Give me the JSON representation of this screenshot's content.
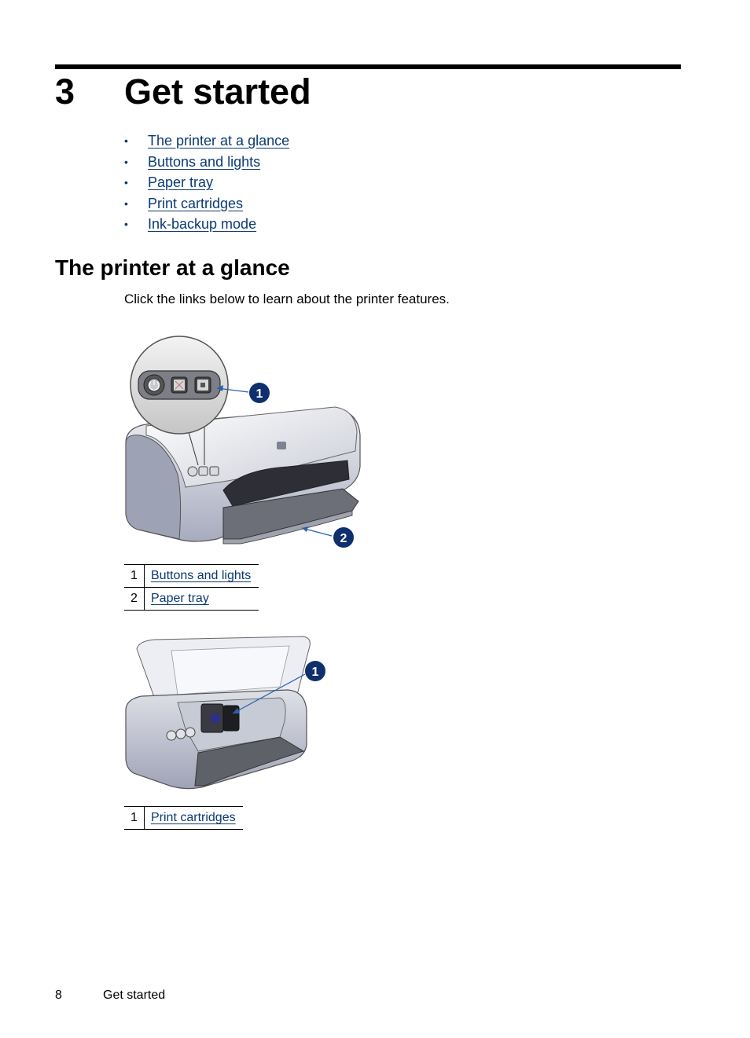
{
  "chapter": {
    "number": "3",
    "title": "Get started"
  },
  "toc": {
    "bullet": "•",
    "items": [
      {
        "label": "The printer at a glance"
      },
      {
        "label": "Buttons and lights"
      },
      {
        "label": "Paper tray"
      },
      {
        "label": "Print cartridges"
      },
      {
        "label": "Ink-backup mode"
      }
    ]
  },
  "section": {
    "title": "The printer at a glance",
    "intro": "Click the links below to learn about the printer features."
  },
  "figure1": {
    "description": "HP printer exterior with zoomed control panel",
    "callouts": [
      "1",
      "2"
    ],
    "legend": [
      {
        "num": "1",
        "label": "Buttons and lights"
      },
      {
        "num": "2",
        "label": "Paper tray"
      }
    ]
  },
  "figure2": {
    "description": "HP printer with cover open showing print cartridges",
    "callouts": [
      "1"
    ],
    "legend": [
      {
        "num": "1",
        "label": "Print cartridges"
      }
    ]
  },
  "footer": {
    "page_number": "8",
    "chapter_title": "Get started"
  },
  "colors": {
    "link": "#0b3a73",
    "callout": "#0f2f6e"
  }
}
